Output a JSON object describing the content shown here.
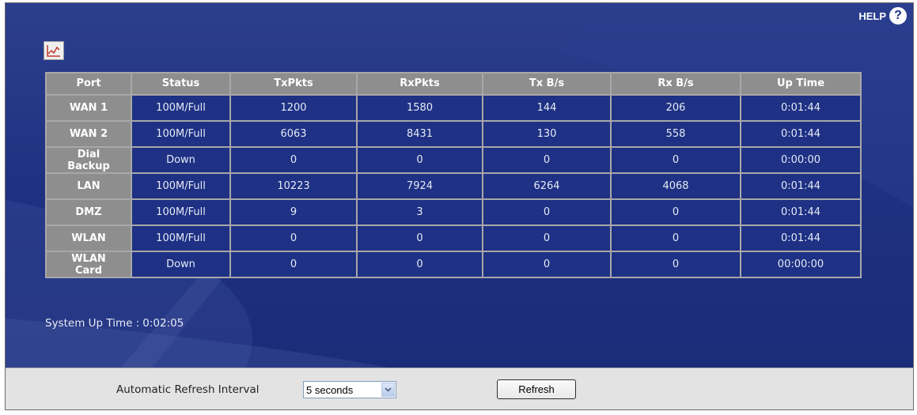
{
  "help": {
    "label": "HELP",
    "icon": "?"
  },
  "graph_button": {
    "icon": "line-graph-icon"
  },
  "table": {
    "headers": [
      "Port",
      "Status",
      "TxPkts",
      "RxPkts",
      "Tx B/s",
      "Rx B/s",
      "Up Time"
    ],
    "rows": [
      {
        "port": "WAN 1",
        "status": "100M/Full",
        "txpkts": "1200",
        "rxpkts": "1580",
        "txbs": "144",
        "rxbs": "206",
        "uptime": "0:01:44"
      },
      {
        "port": "WAN 2",
        "status": "100M/Full",
        "txpkts": "6063",
        "rxpkts": "8431",
        "txbs": "130",
        "rxbs": "558",
        "uptime": "0:01:44"
      },
      {
        "port": "Dial Backup",
        "status": "Down",
        "txpkts": "0",
        "rxpkts": "0",
        "txbs": "0",
        "rxbs": "0",
        "uptime": "0:00:00"
      },
      {
        "port": "LAN",
        "status": "100M/Full",
        "txpkts": "10223",
        "rxpkts": "7924",
        "txbs": "6264",
        "rxbs": "4068",
        "uptime": "0:01:44"
      },
      {
        "port": "DMZ",
        "status": "100M/Full",
        "txpkts": "9",
        "rxpkts": "3",
        "txbs": "0",
        "rxbs": "0",
        "uptime": "0:01:44"
      },
      {
        "port": "WLAN",
        "status": "100M/Full",
        "txpkts": "0",
        "rxpkts": "0",
        "txbs": "0",
        "rxbs": "0",
        "uptime": "0:01:44"
      },
      {
        "port": "WLAN Card",
        "status": "Down",
        "txpkts": "0",
        "rxpkts": "0",
        "txbs": "0",
        "rxbs": "0",
        "uptime": "00:00:00"
      }
    ]
  },
  "system_uptime": {
    "label": "System Up Time :",
    "value": "0:02:05"
  },
  "footer": {
    "refresh_interval_label": "Automatic Refresh Interval",
    "refresh_interval_value": "5 seconds",
    "refresh_button": "Refresh"
  },
  "colors": {
    "background": "#1f3182",
    "header_cell": "#8e8e8e",
    "data_cell": "#1e3184",
    "footer_bar": "#e3e3e3"
  }
}
